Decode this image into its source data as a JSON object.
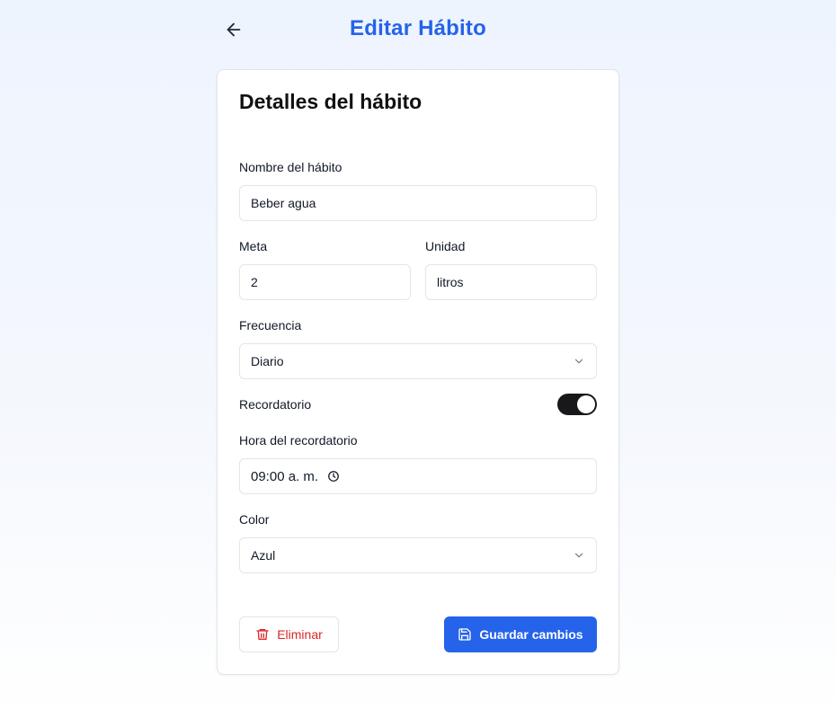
{
  "header": {
    "title": "Editar Hábito",
    "back_icon": "arrow-left-icon"
  },
  "card": {
    "title": "Detalles del hábito"
  },
  "form": {
    "name_label": "Nombre del hábito",
    "name_value": "Beber agua",
    "goal_label": "Meta",
    "goal_value": "2",
    "unit_label": "Unidad",
    "unit_value": "litros",
    "frequency_label": "Frecuencia",
    "frequency_value": "Diario",
    "reminder_label": "Recordatorio",
    "reminder_enabled": true,
    "reminder_time_label": "Hora del recordatorio",
    "reminder_time_value": "09:00 a. m.",
    "color_label": "Color",
    "color_value": "Azul"
  },
  "actions": {
    "delete_label": "Eliminar",
    "save_label": "Guardar cambios"
  },
  "colors": {
    "accent": "#2563eb",
    "danger": "#dc2626",
    "toggle_on": "#18181b"
  }
}
